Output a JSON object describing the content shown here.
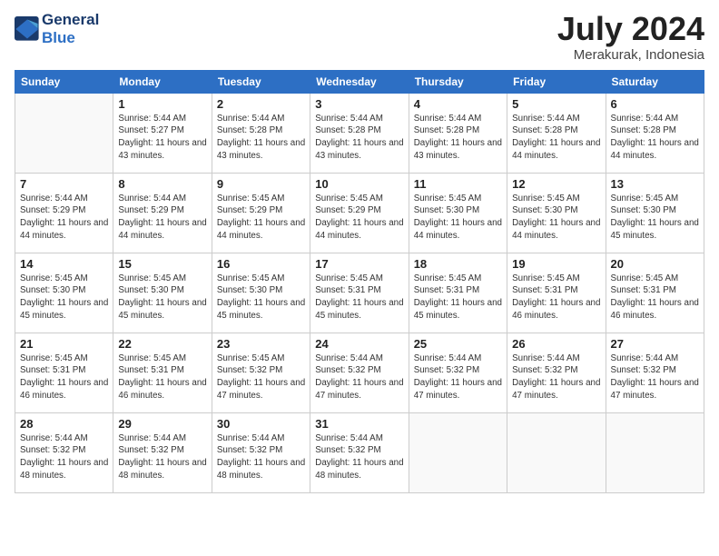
{
  "header": {
    "logo_line1": "General",
    "logo_line2": "Blue",
    "month": "July 2024",
    "location": "Merakurak, Indonesia"
  },
  "weekdays": [
    "Sunday",
    "Monday",
    "Tuesday",
    "Wednesday",
    "Thursday",
    "Friday",
    "Saturday"
  ],
  "weeks": [
    [
      {
        "day": "",
        "sunrise": "",
        "sunset": "",
        "daylight": "",
        "empty": true
      },
      {
        "day": "1",
        "sunrise": "Sunrise: 5:44 AM",
        "sunset": "Sunset: 5:27 PM",
        "daylight": "Daylight: 11 hours and 43 minutes."
      },
      {
        "day": "2",
        "sunrise": "Sunrise: 5:44 AM",
        "sunset": "Sunset: 5:28 PM",
        "daylight": "Daylight: 11 hours and 43 minutes."
      },
      {
        "day": "3",
        "sunrise": "Sunrise: 5:44 AM",
        "sunset": "Sunset: 5:28 PM",
        "daylight": "Daylight: 11 hours and 43 minutes."
      },
      {
        "day": "4",
        "sunrise": "Sunrise: 5:44 AM",
        "sunset": "Sunset: 5:28 PM",
        "daylight": "Daylight: 11 hours and 43 minutes."
      },
      {
        "day": "5",
        "sunrise": "Sunrise: 5:44 AM",
        "sunset": "Sunset: 5:28 PM",
        "daylight": "Daylight: 11 hours and 44 minutes."
      },
      {
        "day": "6",
        "sunrise": "Sunrise: 5:44 AM",
        "sunset": "Sunset: 5:28 PM",
        "daylight": "Daylight: 11 hours and 44 minutes."
      }
    ],
    [
      {
        "day": "7",
        "sunrise": "Sunrise: 5:44 AM",
        "sunset": "Sunset: 5:29 PM",
        "daylight": "Daylight: 11 hours and 44 minutes."
      },
      {
        "day": "8",
        "sunrise": "Sunrise: 5:44 AM",
        "sunset": "Sunset: 5:29 PM",
        "daylight": "Daylight: 11 hours and 44 minutes."
      },
      {
        "day": "9",
        "sunrise": "Sunrise: 5:45 AM",
        "sunset": "Sunset: 5:29 PM",
        "daylight": "Daylight: 11 hours and 44 minutes."
      },
      {
        "day": "10",
        "sunrise": "Sunrise: 5:45 AM",
        "sunset": "Sunset: 5:29 PM",
        "daylight": "Daylight: 11 hours and 44 minutes."
      },
      {
        "day": "11",
        "sunrise": "Sunrise: 5:45 AM",
        "sunset": "Sunset: 5:30 PM",
        "daylight": "Daylight: 11 hours and 44 minutes."
      },
      {
        "day": "12",
        "sunrise": "Sunrise: 5:45 AM",
        "sunset": "Sunset: 5:30 PM",
        "daylight": "Daylight: 11 hours and 44 minutes."
      },
      {
        "day": "13",
        "sunrise": "Sunrise: 5:45 AM",
        "sunset": "Sunset: 5:30 PM",
        "daylight": "Daylight: 11 hours and 45 minutes."
      }
    ],
    [
      {
        "day": "14",
        "sunrise": "Sunrise: 5:45 AM",
        "sunset": "Sunset: 5:30 PM",
        "daylight": "Daylight: 11 hours and 45 minutes."
      },
      {
        "day": "15",
        "sunrise": "Sunrise: 5:45 AM",
        "sunset": "Sunset: 5:30 PM",
        "daylight": "Daylight: 11 hours and 45 minutes."
      },
      {
        "day": "16",
        "sunrise": "Sunrise: 5:45 AM",
        "sunset": "Sunset: 5:30 PM",
        "daylight": "Daylight: 11 hours and 45 minutes."
      },
      {
        "day": "17",
        "sunrise": "Sunrise: 5:45 AM",
        "sunset": "Sunset: 5:31 PM",
        "daylight": "Daylight: 11 hours and 45 minutes."
      },
      {
        "day": "18",
        "sunrise": "Sunrise: 5:45 AM",
        "sunset": "Sunset: 5:31 PM",
        "daylight": "Daylight: 11 hours and 45 minutes."
      },
      {
        "day": "19",
        "sunrise": "Sunrise: 5:45 AM",
        "sunset": "Sunset: 5:31 PM",
        "daylight": "Daylight: 11 hours and 46 minutes."
      },
      {
        "day": "20",
        "sunrise": "Sunrise: 5:45 AM",
        "sunset": "Sunset: 5:31 PM",
        "daylight": "Daylight: 11 hours and 46 minutes."
      }
    ],
    [
      {
        "day": "21",
        "sunrise": "Sunrise: 5:45 AM",
        "sunset": "Sunset: 5:31 PM",
        "daylight": "Daylight: 11 hours and 46 minutes."
      },
      {
        "day": "22",
        "sunrise": "Sunrise: 5:45 AM",
        "sunset": "Sunset: 5:31 PM",
        "daylight": "Daylight: 11 hours and 46 minutes."
      },
      {
        "day": "23",
        "sunrise": "Sunrise: 5:45 AM",
        "sunset": "Sunset: 5:32 PM",
        "daylight": "Daylight: 11 hours and 47 minutes."
      },
      {
        "day": "24",
        "sunrise": "Sunrise: 5:44 AM",
        "sunset": "Sunset: 5:32 PM",
        "daylight": "Daylight: 11 hours and 47 minutes."
      },
      {
        "day": "25",
        "sunrise": "Sunrise: 5:44 AM",
        "sunset": "Sunset: 5:32 PM",
        "daylight": "Daylight: 11 hours and 47 minutes."
      },
      {
        "day": "26",
        "sunrise": "Sunrise: 5:44 AM",
        "sunset": "Sunset: 5:32 PM",
        "daylight": "Daylight: 11 hours and 47 minutes."
      },
      {
        "day": "27",
        "sunrise": "Sunrise: 5:44 AM",
        "sunset": "Sunset: 5:32 PM",
        "daylight": "Daylight: 11 hours and 47 minutes."
      }
    ],
    [
      {
        "day": "28",
        "sunrise": "Sunrise: 5:44 AM",
        "sunset": "Sunset: 5:32 PM",
        "daylight": "Daylight: 11 hours and 48 minutes."
      },
      {
        "day": "29",
        "sunrise": "Sunrise: 5:44 AM",
        "sunset": "Sunset: 5:32 PM",
        "daylight": "Daylight: 11 hours and 48 minutes."
      },
      {
        "day": "30",
        "sunrise": "Sunrise: 5:44 AM",
        "sunset": "Sunset: 5:32 PM",
        "daylight": "Daylight: 11 hours and 48 minutes."
      },
      {
        "day": "31",
        "sunrise": "Sunrise: 5:44 AM",
        "sunset": "Sunset: 5:32 PM",
        "daylight": "Daylight: 11 hours and 48 minutes."
      },
      {
        "day": "",
        "sunrise": "",
        "sunset": "",
        "daylight": "",
        "empty": true
      },
      {
        "day": "",
        "sunrise": "",
        "sunset": "",
        "daylight": "",
        "empty": true
      },
      {
        "day": "",
        "sunrise": "",
        "sunset": "",
        "daylight": "",
        "empty": true
      }
    ]
  ]
}
